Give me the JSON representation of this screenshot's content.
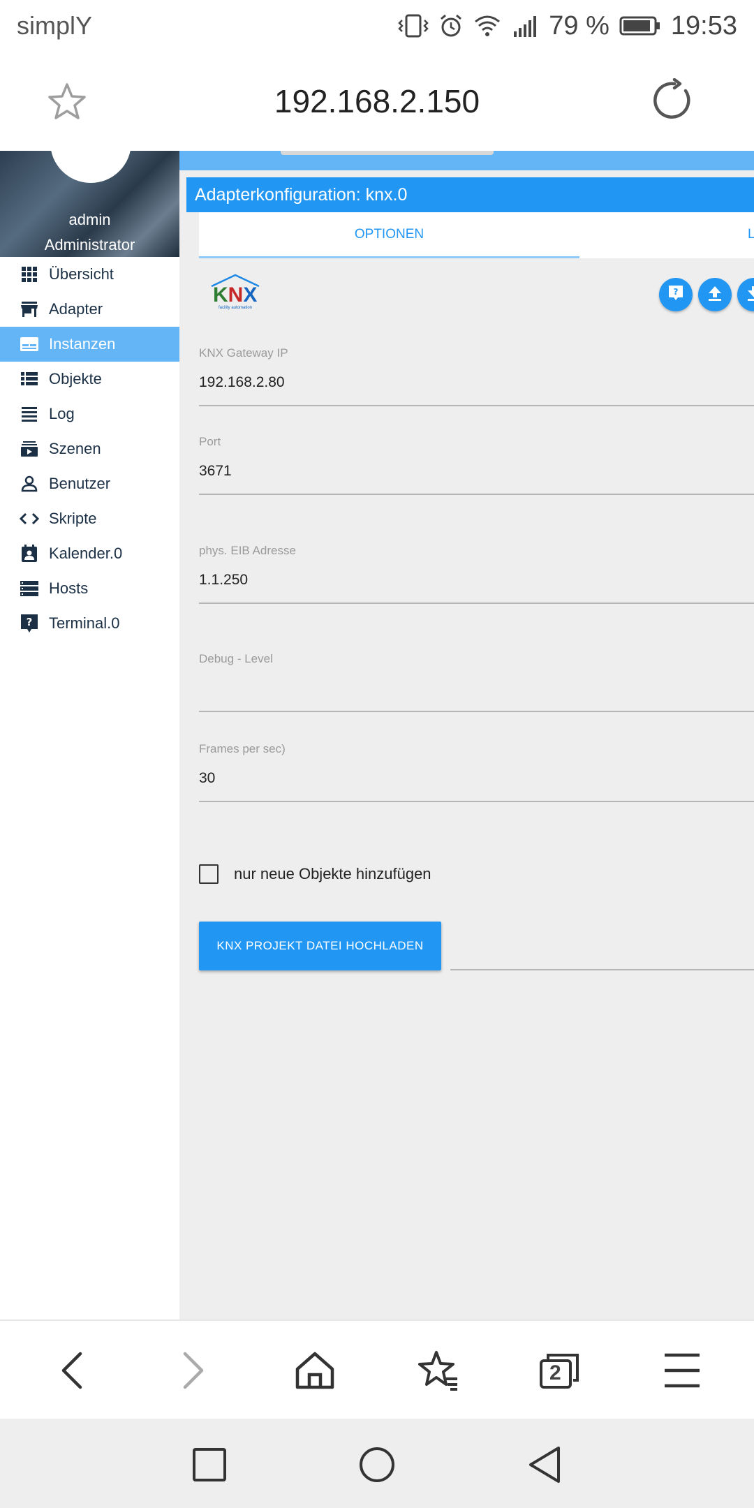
{
  "status_bar": {
    "carrier": "simplY",
    "battery_percent": "79 %",
    "time": "19:53"
  },
  "browser": {
    "url": "192.168.2.150",
    "tab_count": "2"
  },
  "sidebar": {
    "user_name": "admin",
    "user_role": "Administrator",
    "items": [
      {
        "label": "Übersicht",
        "icon": "grid-icon"
      },
      {
        "label": "Adapter",
        "icon": "store-icon"
      },
      {
        "label": "Instanzen",
        "icon": "instances-icon",
        "active": true
      },
      {
        "label": "Objekte",
        "icon": "list-icon"
      },
      {
        "label": "Log",
        "icon": "log-icon"
      },
      {
        "label": "Szenen",
        "icon": "scenes-icon"
      },
      {
        "label": "Benutzer",
        "icon": "user-icon"
      },
      {
        "label": "Skripte",
        "icon": "code-icon"
      },
      {
        "label": "Kalender.0",
        "icon": "calendar-icon"
      },
      {
        "label": "Hosts",
        "icon": "hosts-icon"
      },
      {
        "label": "Terminal.0",
        "icon": "help-icon"
      }
    ]
  },
  "config": {
    "title": "Adapterkonfiguration: knx.0",
    "tabs": [
      "OPTIONEN",
      "L"
    ],
    "logo_text": "KNX",
    "logo_subtext": "facility automation",
    "fields": [
      {
        "label": "KNX Gateway IP",
        "value": "192.168.2.80"
      },
      {
        "label": "Port",
        "value": "3671"
      },
      {
        "label": "phys. EIB Adresse",
        "value": "1.1.250"
      },
      {
        "label": "Debug - Level",
        "value": ""
      },
      {
        "label": "Frames per sec)",
        "value": "30"
      }
    ],
    "checkbox_label": "nur neue Objekte hinzufügen",
    "upload_button": "KNX PROJEKT DATEI HOCHLADEN"
  },
  "colors": {
    "accent": "#2196f3",
    "active_nav": "#64b5f6",
    "content_bg": "#eeeeee"
  }
}
